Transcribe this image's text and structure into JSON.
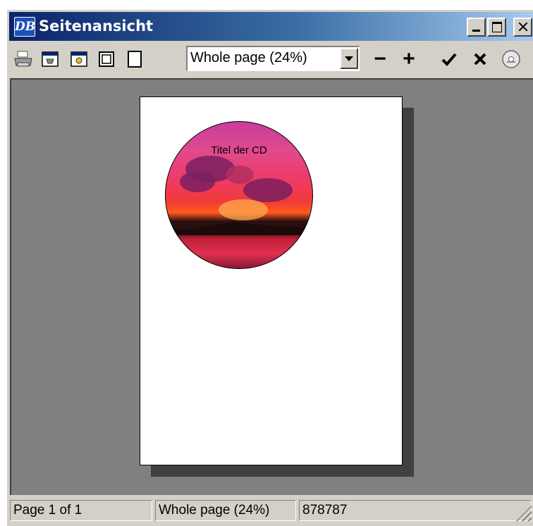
{
  "window": {
    "title": "Seitenansicht",
    "app_icon_text": "DB"
  },
  "toolbar": {
    "zoom_value": "Whole page (24%)",
    "zoom_out_label": "−",
    "zoom_in_label": "+"
  },
  "page": {
    "disc_title": "Titel der CD"
  },
  "status": {
    "page_info": "Page 1 of 1",
    "zoom_info": "Whole page (24%)",
    "value": "878787"
  }
}
